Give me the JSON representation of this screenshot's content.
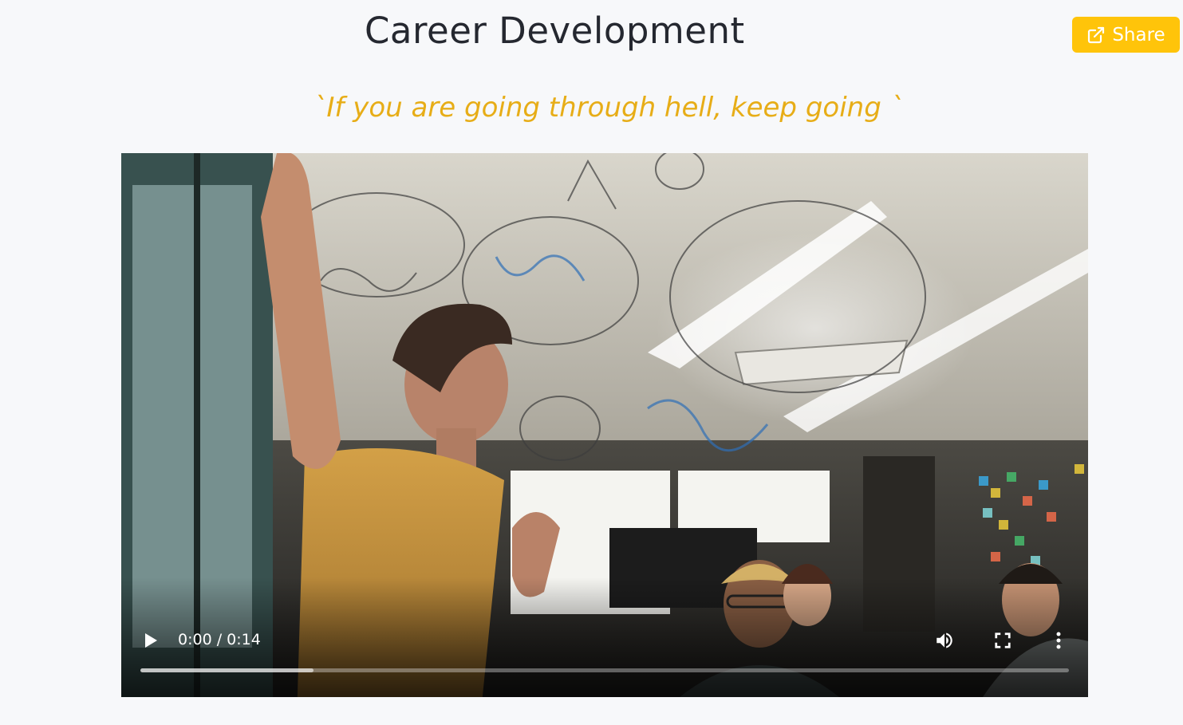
{
  "header": {
    "title": "Career Development",
    "share_label": "Share"
  },
  "quote": "`If you are going through hell, keep going `",
  "video": {
    "time_display": "0:00 / 0:14",
    "current_time": "0:00",
    "duration": "0:14",
    "buffered_fraction": 0.186,
    "state": "paused"
  },
  "icons": {
    "share": "external-link-icon",
    "play": "play-icon",
    "volume": "volume-icon",
    "fullscreen": "fullscreen-icon",
    "more": "more-vertical-icon"
  },
  "colors": {
    "background": "#f7f8fa",
    "title": "#252830",
    "accent": "#ffc40a",
    "quote": "#e7ad17"
  }
}
